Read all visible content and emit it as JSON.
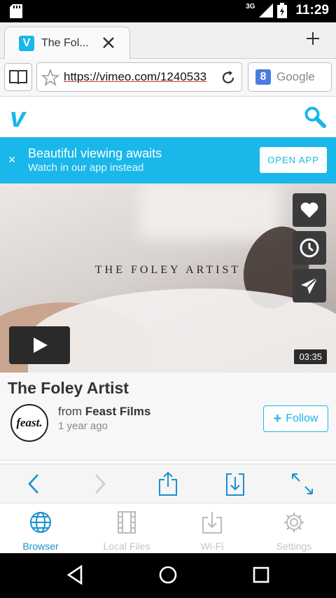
{
  "status_bar": {
    "network": "3G",
    "time": "11:29"
  },
  "browser": {
    "tab": {
      "favicon": "V",
      "title": "The Fol..."
    },
    "url": "https://vimeo.com/1240533",
    "search_engine": {
      "badge": "8",
      "label": "Google"
    }
  },
  "site": {
    "logo": "v"
  },
  "banner": {
    "close": "×",
    "title": "Beautiful viewing awaits",
    "subtitle": "Watch in our app instead",
    "button": "OPEN APP"
  },
  "video": {
    "overlay_title": "THE FOLEY ARTIST",
    "duration": "03:35",
    "actions": [
      "heart-icon",
      "clock-icon",
      "send-icon"
    ]
  },
  "info": {
    "title": "The Foley Artist",
    "avatar_text": "feast.",
    "from_label": "from",
    "author": "Feast Films",
    "age": "1 year ago",
    "follow": "Follow",
    "follow_plus": "+"
  },
  "bottom_tabs": [
    {
      "label": "Browser",
      "icon": "globe-icon",
      "active": true
    },
    {
      "label": "Local Files",
      "icon": "film-icon",
      "active": false
    },
    {
      "label": "Wi-Fi",
      "icon": "download-tray-icon",
      "active": false
    },
    {
      "label": "Settings",
      "icon": "gear-icon",
      "active": false
    }
  ],
  "colors": {
    "accent": "#1ab7ea",
    "tab_active": "#1a8fd0"
  }
}
